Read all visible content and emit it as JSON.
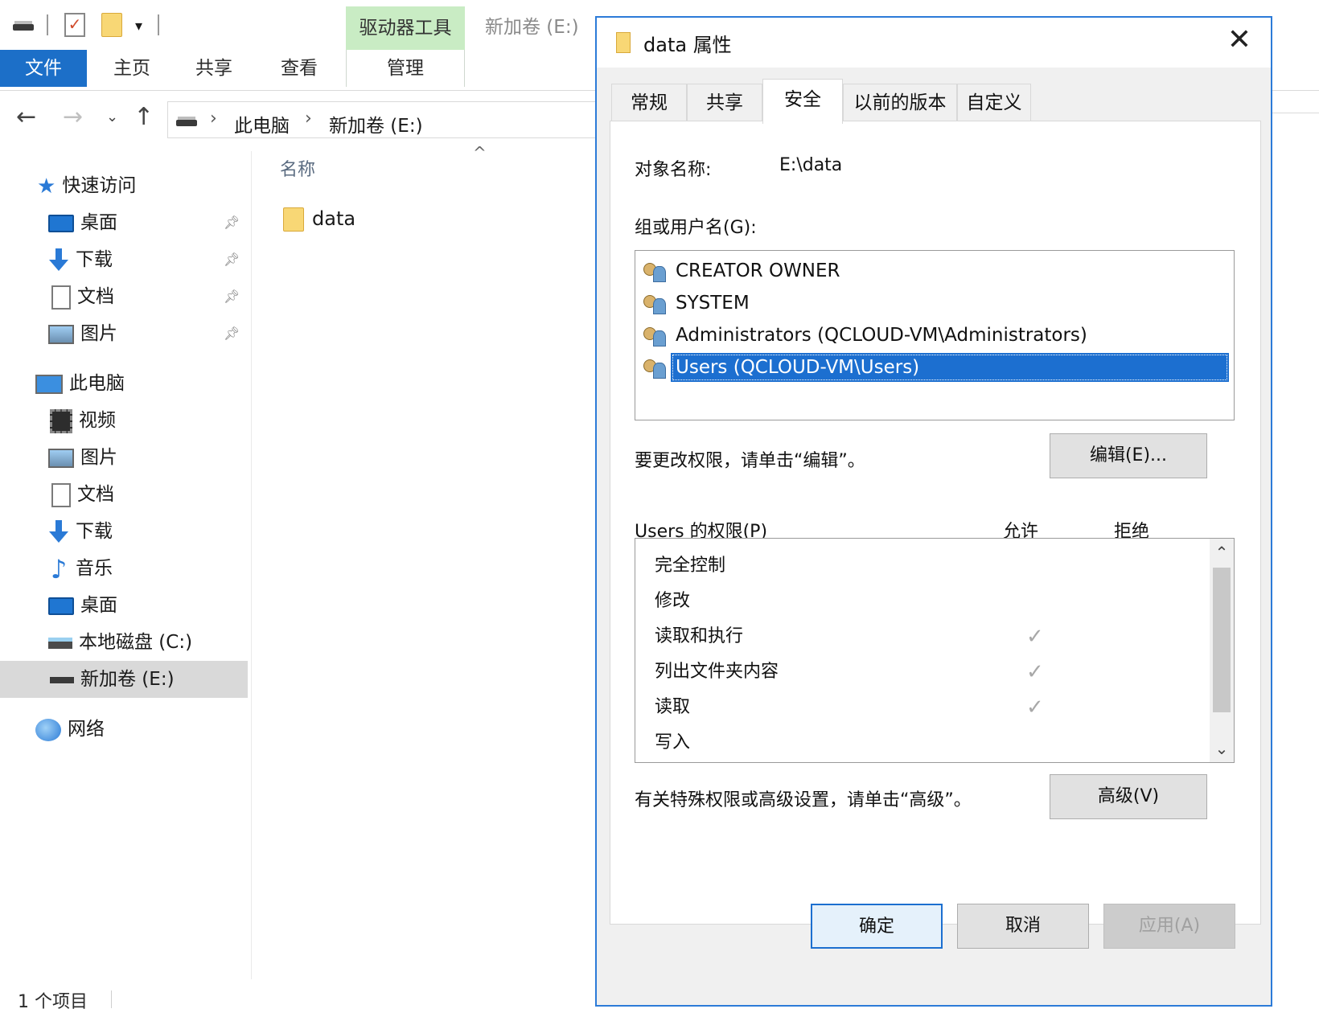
{
  "explorer": {
    "ribbon": {
      "tabs": [
        "文件",
        "主页",
        "共享",
        "查看"
      ],
      "context_group": "驱动器工具",
      "context_tab": "管理",
      "window_title": "新加卷 (E:)"
    },
    "address": {
      "crumbs": [
        "此电脑",
        "新加卷 (E:)"
      ]
    },
    "nav": {
      "quick_access": "快速访问",
      "quick_items": [
        "桌面",
        "下载",
        "文档",
        "图片"
      ],
      "this_pc": "此电脑",
      "pc_items": [
        "视频",
        "图片",
        "文档",
        "下载",
        "音乐",
        "桌面",
        "本地磁盘 (C:)",
        "新加卷 (E:)"
      ],
      "network": "网络",
      "selected": "新加卷 (E:)"
    },
    "list": {
      "column_name": "名称",
      "files": [
        "data"
      ]
    },
    "status": "1 个项目"
  },
  "dialog": {
    "title": "data 属性",
    "tabs": [
      "常规",
      "共享",
      "安全",
      "以前的版本",
      "自定义"
    ],
    "active_tab": "安全",
    "object_name_label": "对象名称:",
    "object_name_value": "E:\\data",
    "group_label": "组或用户名(G):",
    "users": [
      "CREATOR OWNER",
      "SYSTEM",
      "Administrators (QCLOUD-VM\\Administrators)",
      "Users (QCLOUD-VM\\Users)"
    ],
    "selected_user": "Users (QCLOUD-VM\\Users)",
    "change_perm_text": "要更改权限，请单击“编辑”。",
    "edit_button": "编辑(E)...",
    "perm_header": "Users 的权限(P)",
    "allow_header": "允许",
    "deny_header": "拒绝",
    "permissions": [
      {
        "name": "完全控制",
        "allow": "",
        "deny": ""
      },
      {
        "name": "修改",
        "allow": "",
        "deny": ""
      },
      {
        "name": "读取和执行",
        "allow": "✓",
        "deny": ""
      },
      {
        "name": "列出文件夹内容",
        "allow": "✓",
        "deny": ""
      },
      {
        "name": "读取",
        "allow": "✓",
        "deny": ""
      },
      {
        "name": "写入",
        "allow": "",
        "deny": ""
      }
    ],
    "advanced_text": "有关特殊权限或高级设置，请单击“高级”。",
    "advanced_button": "高级(V)",
    "ok_button": "确定",
    "cancel_button": "取消",
    "apply_button": "应用(A)"
  }
}
